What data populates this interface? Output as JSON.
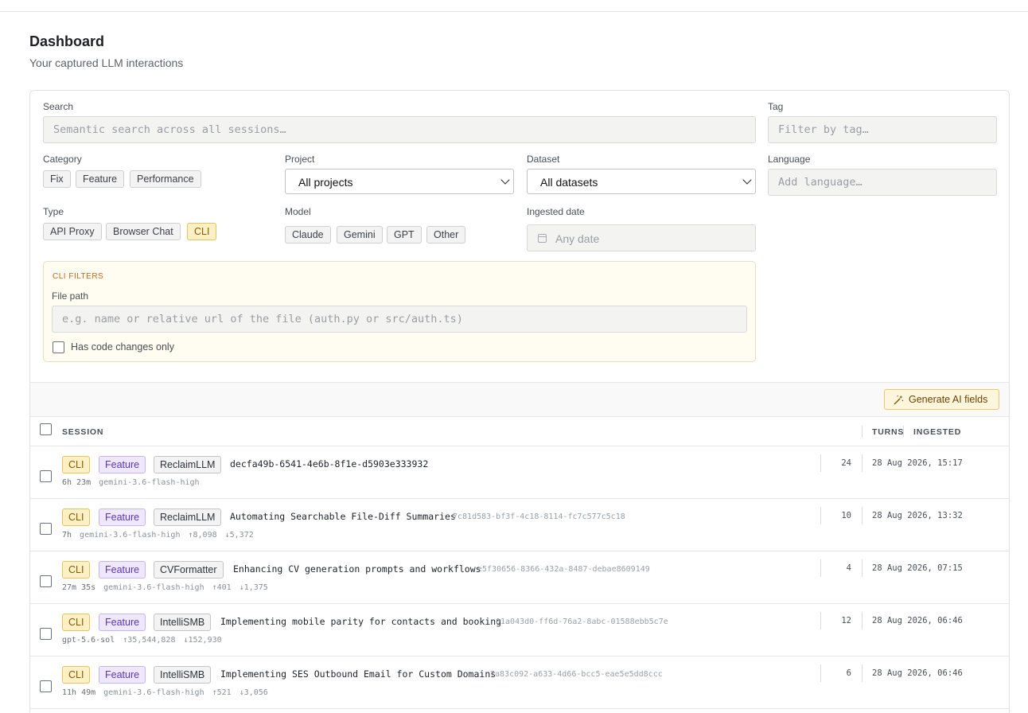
{
  "page": {
    "title": "Dashboard",
    "subtitle": "Your captured LLM interactions"
  },
  "filters": {
    "search": {
      "label": "Search",
      "placeholder": "Semantic search across all sessions…"
    },
    "tag": {
      "label": "Tag",
      "placeholder": "Filter by tag…"
    },
    "category": {
      "label": "Category",
      "options": [
        "Fix",
        "Feature",
        "Performance"
      ]
    },
    "project": {
      "label": "Project",
      "selected": "All projects"
    },
    "dataset": {
      "label": "Dataset",
      "selected": "All datasets"
    },
    "language": {
      "label": "Language",
      "placeholder": "Add language…"
    },
    "type": {
      "label": "Type",
      "options": [
        "API Proxy",
        "Browser Chat",
        "CLI"
      ],
      "active": "CLI"
    },
    "model": {
      "label": "Model",
      "options": [
        "Claude",
        "Gemini",
        "GPT",
        "Other"
      ]
    },
    "ingested_date": {
      "label": "Ingested date",
      "placeholder": "Any date",
      "icon": "calendar-icon"
    },
    "cli": {
      "title": "CLI FILTERS",
      "file_path_label": "File path",
      "file_path_placeholder": "e.g. name or relative url of the file (auth.py or src/auth.ts)",
      "code_changes_label": "Has code changes only"
    }
  },
  "toolbar": {
    "generate_label": "Generate AI fields",
    "icon": "magic-wand-icon"
  },
  "table": {
    "columns": {
      "session": "SESSION",
      "turns": "TURNS",
      "ingested": "INGESTED"
    },
    "rows": [
      {
        "type": "CLI",
        "category": "Feature",
        "project": "ReclaimLLM",
        "title": "decfa49b-6541-4e6b-8f1e-d5903e333932",
        "id": "",
        "duration": "6h 23m",
        "model": "gemini-3.6-flash-high",
        "tokens_in": "",
        "tokens_out": "",
        "turns": "24",
        "ingested": "28 Aug 2026, 15:17"
      },
      {
        "type": "CLI",
        "category": "Feature",
        "project": "ReclaimLLM",
        "title": "Automating Searchable File-Diff Summaries",
        "id": "7c81d583-bf3f-4c18-8114-fc7c577c5c18",
        "duration": "7h",
        "model": "gemini-3.6-flash-high",
        "tokens_in": "↑8,098",
        "tokens_out": "↓5,372",
        "turns": "10",
        "ingested": "28 Aug 2026, 13:32"
      },
      {
        "type": "CLI",
        "category": "Feature",
        "project": "CVFormatter",
        "title": "Enhancing CV generation prompts and workflows",
        "id": "e5f30656-8366-432a-8487-debae8609149",
        "duration": "27m 35s",
        "model": "gemini-3.6-flash-high",
        "tokens_in": "↑401",
        "tokens_out": "↓1,375",
        "turns": "4",
        "ingested": "28 Aug 2026, 07:15"
      },
      {
        "type": "CLI",
        "category": "Feature",
        "project": "IntelliSMB",
        "title": "Implementing mobile parity for contacts and booking",
        "id": "01a043d0-ff6d-76a2-8abc-01588ebb5c7e",
        "duration": "gpt-5.6-sol",
        "model": "",
        "tokens_in": "↑35,544,828",
        "tokens_out": "↓152,930",
        "turns": "12",
        "ingested": "28 Aug 2026, 06:46"
      },
      {
        "type": "CLI",
        "category": "Feature",
        "project": "IntelliSMB",
        "title": "Implementing SES Outbound Email for Custom Domains",
        "id": "7a83c092-a633-4d66-bcc5-eae5e5dd8ccc",
        "duration": "11h 49m",
        "model": "gemini-3.6-flash-high",
        "tokens_in": "↑521",
        "tokens_out": "↓3,056",
        "turns": "6",
        "ingested": "28 Aug 2026, 06:46"
      }
    ]
  }
}
